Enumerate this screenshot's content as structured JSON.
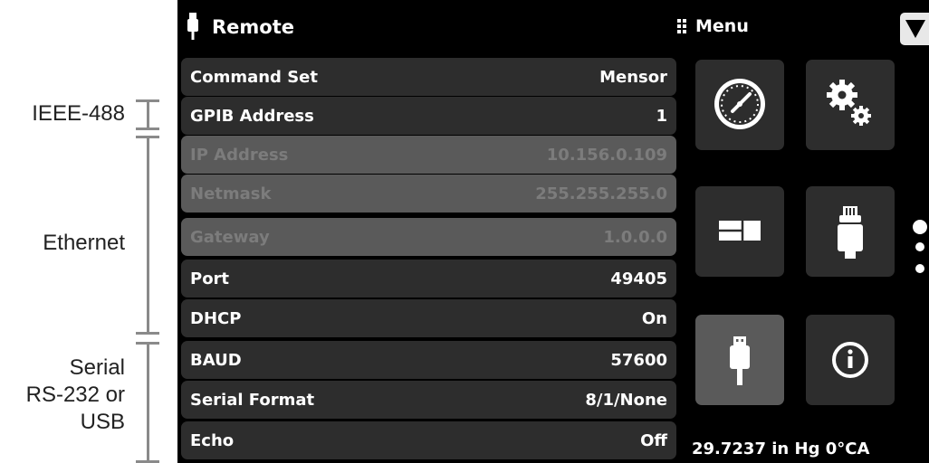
{
  "annotations": {
    "ieee": "IEEE-488",
    "ethernet": "Ethernet",
    "serial_l1": "Serial",
    "serial_l2": "RS-232 or",
    "serial_l3": "USB"
  },
  "header": {
    "title": "Remote",
    "title_icon": "usb-plug-icon",
    "menu_label": "Menu",
    "menu_icon": "grip-icon",
    "dropdown_icon": "triangle-down-icon"
  },
  "settings": [
    {
      "label": "Command Set",
      "value": "Mensor",
      "enabled": true
    },
    {
      "label": "GPIB Address",
      "value": "1",
      "enabled": true
    },
    {
      "label": "IP Address",
      "value": "10.156.0.109",
      "enabled": false
    },
    {
      "label": "Netmask",
      "value": "255.255.255.0",
      "enabled": false
    },
    {
      "label": "Gateway",
      "value": "1.0.0.0",
      "enabled": false
    },
    {
      "label": "Port",
      "value": "49405",
      "enabled": true
    },
    {
      "label": "DHCP",
      "value": "On",
      "enabled": true
    },
    {
      "label": "BAUD",
      "value": "57600",
      "enabled": true
    },
    {
      "label": "Serial Format",
      "value": "8/1/None",
      "enabled": true
    },
    {
      "label": "Echo",
      "value": "Off",
      "enabled": true
    }
  ],
  "menu_tiles": [
    {
      "icon": "gauge-icon",
      "selected": false
    },
    {
      "icon": "gears-icon",
      "selected": false
    },
    {
      "icon": "display-layout-icon",
      "selected": false
    },
    {
      "icon": "transducer-icon",
      "selected": false
    },
    {
      "icon": "usb-plug-icon",
      "selected": true
    },
    {
      "icon": "info-icon",
      "selected": false
    }
  ],
  "page_indicator": {
    "count": 3,
    "current": 1
  },
  "status": {
    "barometer": "29.7237 in Hg 0°CA"
  },
  "colors": {
    "background": "#000000",
    "row": "#2d2d2d",
    "row_disabled": "#5a5a5a",
    "text_disabled": "#7c7c7c",
    "bracket": "#8a8a8a"
  }
}
